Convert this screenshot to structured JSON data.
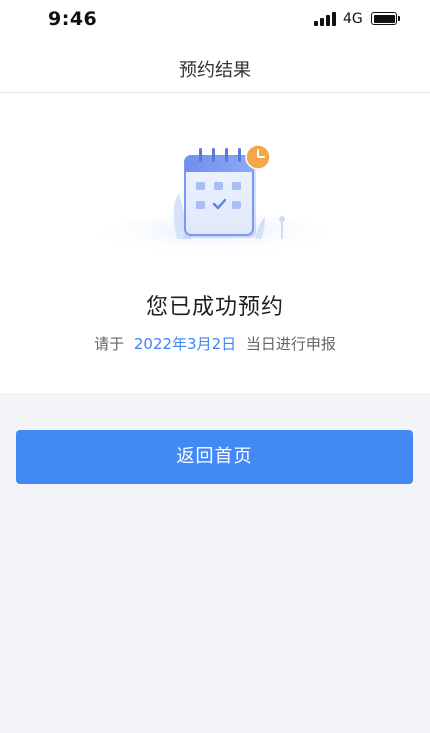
{
  "status_bar": {
    "time": "9:46",
    "network": "4G",
    "icons": [
      "signal-icon",
      "battery-icon"
    ]
  },
  "nav": {
    "title": "预约结果"
  },
  "result": {
    "illustration": "calendar-check-illustration",
    "title": "您已成功预约",
    "subtitle_prefix": "请于",
    "date": "2022年3月2日",
    "subtitle_suffix": "当日进行申报"
  },
  "actions": {
    "home_button_label": "返回首页"
  },
  "colors": {
    "accent": "#4289f5",
    "date_text": "#3e84f3",
    "page_background": "#f3f4f7",
    "card_background": "#ffffff"
  }
}
